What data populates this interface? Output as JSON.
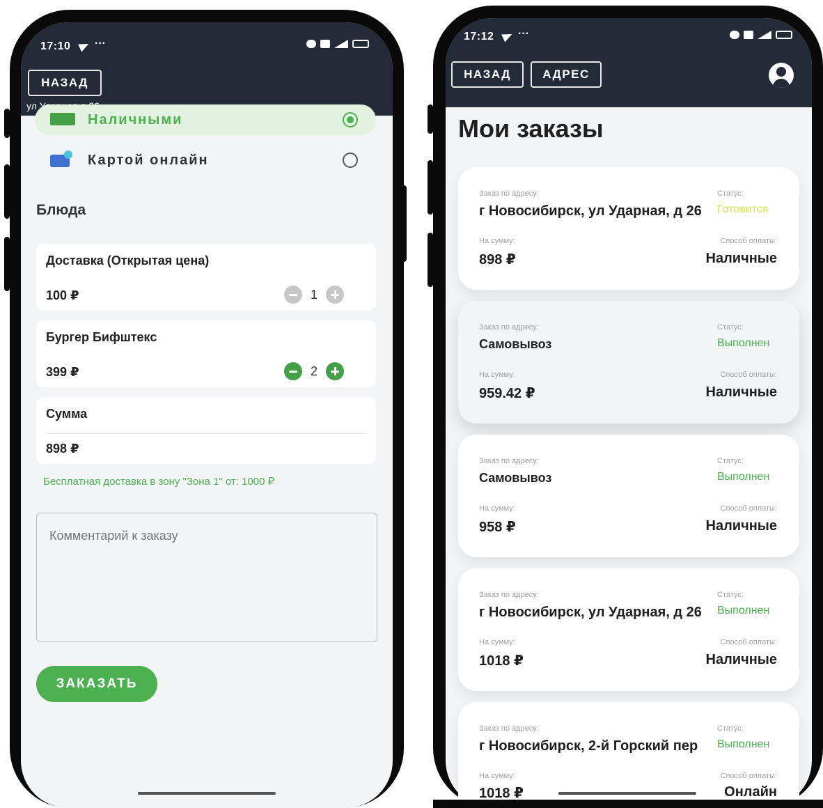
{
  "left_phone": {
    "status_time": "17:10",
    "back_label": "НАЗАД",
    "address": "ул Ударная,д 26",
    "payment_options": [
      {
        "label": "Наличными",
        "selected": true
      },
      {
        "label": "Картой онлайн",
        "selected": false
      }
    ],
    "dishes_heading": "Блюда",
    "items": [
      {
        "name": "Доставка (Открытая цена)",
        "price": "100 ₽",
        "qty": "1",
        "active": false
      },
      {
        "name": "Бургер Бифштекс",
        "price": "399 ₽",
        "qty": "2",
        "active": true
      }
    ],
    "total_label": "Сумма",
    "total_value": "898 ₽",
    "free_delivery": "Бесплатная доставка в зону \"Зона 1\" от: 1000 ₽",
    "comment_placeholder": "Комментарий к заказу",
    "order_button": "ЗАКАЗАТЬ"
  },
  "right_phone": {
    "status_time": "17:12",
    "back_label": "НАЗАД",
    "address_label": "АДРЕС",
    "title": "Мои заказы",
    "orders": [
      {
        "address_label": "Заказ по адресу:",
        "address": "г Новосибирск, ул Ударная, д 26",
        "status_label": "Статус:",
        "status": "Готовится",
        "sum_label": "На сумму:",
        "sum": "898 ₽",
        "pay_label": "Способ оплаты:",
        "pay": "Наличные"
      },
      {
        "address_label": "Заказ по адресу:",
        "address": "Самовывоз",
        "status_label": "Статус:",
        "status": "Выполнен",
        "sum_label": "На сумму:",
        "sum": "959.42 ₽",
        "pay_label": "Способ оплаты:",
        "pay": "Наличные"
      },
      {
        "address_label": "Заказ по адресу:",
        "address": "Самовывоз",
        "status_label": "Статус:",
        "status": "Выполнен",
        "sum_label": "На сумму:",
        "sum": "958 ₽",
        "pay_label": "Способ оплаты:",
        "pay": "Наличные"
      },
      {
        "address_label": "Заказ по адресу:",
        "address": "г Новосибирск, ул Ударная, д 26",
        "status_label": "Статус:",
        "status": "Выполнен",
        "sum_label": "На сумму:",
        "sum": "1018 ₽",
        "pay_label": "Способ оплаты:",
        "pay": "Наличные"
      },
      {
        "address_label": "Заказ по адресу:",
        "address": "г Новосибирск, 2-й Горский пер",
        "status_label": "Статус:",
        "status": "Выполнен",
        "sum_label": "На сумму:",
        "sum": "1018 ₽",
        "pay_label": "Способ оплаты:",
        "pay": "Онлайн"
      }
    ]
  },
  "colors": {
    "app_bar": "#222b37",
    "accent_green": "#4caf50",
    "selected_row": "#e3f1e1",
    "status_cooking": "#d8e24a",
    "status_done": "#4caf50",
    "stepper_disabled": "#c7c7c7"
  }
}
